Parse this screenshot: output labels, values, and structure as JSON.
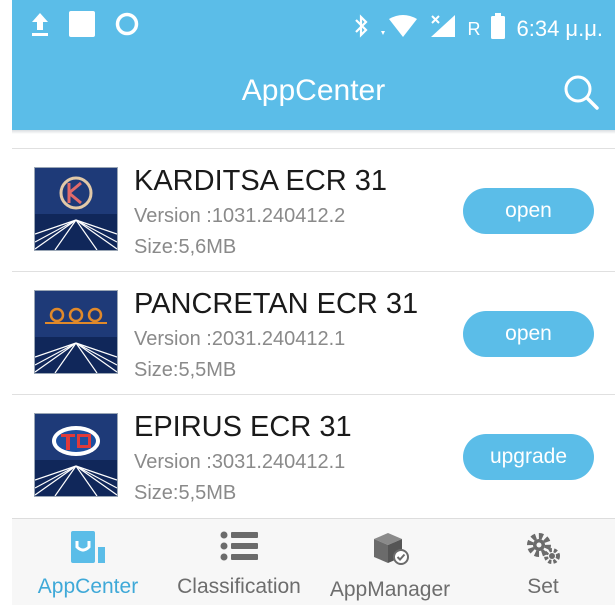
{
  "status_bar": {
    "time": "6:34 μ.μ.",
    "network_letter": "R",
    "left_icons": [
      "upload-icon",
      "square-icon",
      "sync-circle-icon"
    ],
    "right_icons": [
      "bluetooth-icon",
      "wifi-icon",
      "signal-icon",
      "battery-icon"
    ]
  },
  "header": {
    "title": "AppCenter",
    "search_icon": "search-icon"
  },
  "apps": [
    {
      "name": "KARDITSA ECR 31",
      "version": "Version :1031.240412.2",
      "size": "Size:5,6MB",
      "action": "open"
    },
    {
      "name": "PANCRETAN ECR 31",
      "version": "Version :2031.240412.1",
      "size": "Size:5,5MB",
      "action": "open"
    },
    {
      "name": "EPIRUS ECR 31",
      "version": "Version :3031.240412.1",
      "size": "Size:5,5MB",
      "action": "upgrade"
    }
  ],
  "bottom_nav": {
    "items": [
      {
        "label": "AppCenter",
        "icon": "appcenter-icon",
        "active": true
      },
      {
        "label": "Classification",
        "icon": "list-icon",
        "active": false
      },
      {
        "label": "AppManager",
        "icon": "box-icon",
        "active": false
      },
      {
        "label": "Set",
        "icon": "gear-icon",
        "active": false
      }
    ]
  },
  "colors": {
    "primary": "#5bbde8",
    "active_nav": "#3fa9d8",
    "inactive_nav": "#6d6d6d"
  }
}
